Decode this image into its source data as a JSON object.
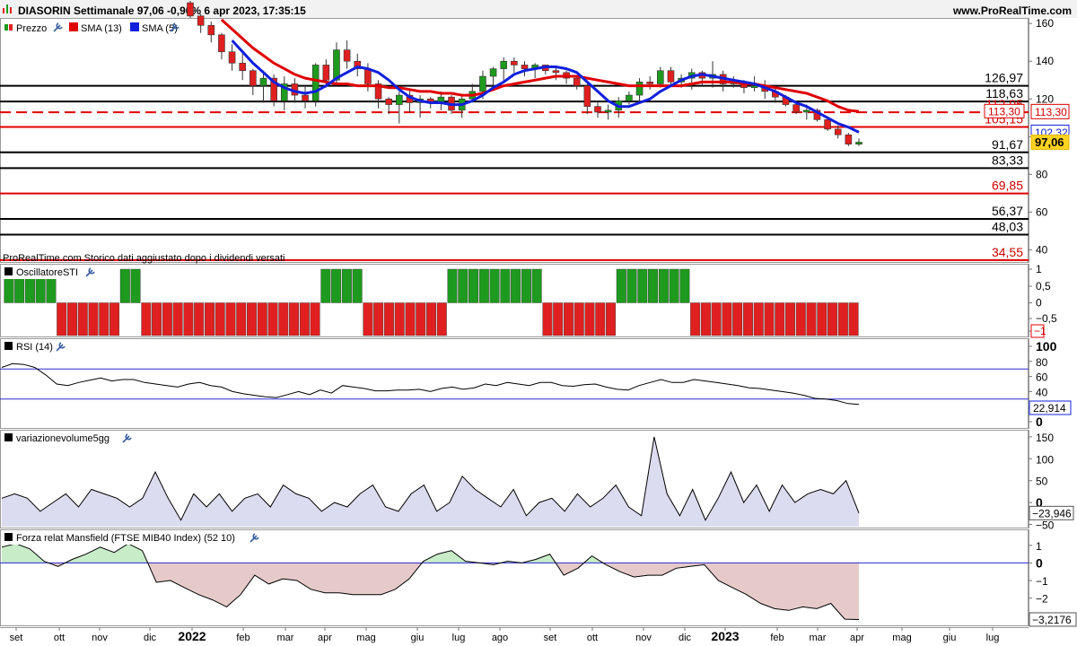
{
  "header": {
    "title": "DIASORIN Settimanale 97,06 -0,96% 6 apr 2023, 17:35:15",
    "site": "www.ProRealTime.com"
  },
  "colors": {
    "up": "#1e9a1e",
    "down": "#e02020",
    "sma13": "#e00000",
    "sma5": "#1020dd",
    "osc_pos": "#1e9a1e",
    "osc_neg": "#e02020",
    "indicator_line": "#000000",
    "level_line": "#2a2acc",
    "volume_fill": "#dcdcf0",
    "mansfield_pos_fill": "#c8ecc8",
    "mansfield_neg_fill": "#e6caca"
  },
  "price_pane": {
    "legend": [
      {
        "icon": "candlestick-icon",
        "label": "Prezzo"
      },
      {
        "icon": "red-square-icon",
        "label": "SMA (13)"
      },
      {
        "icon": "blue-square-icon",
        "label": "SMA (5)"
      }
    ],
    "note": "ProRealTime.com  Storico dati aggiustato dopo i dividendi versati",
    "ylim": [
      34,
      162
    ],
    "yticks": [
      "160",
      "140",
      "120",
      "100",
      "80",
      "60",
      "40"
    ],
    "levels": [
      {
        "label": "126,97",
        "value": 126.97,
        "style": "black-solid"
      },
      {
        "label": "118,63",
        "value": 118.63,
        "style": "black-solid"
      },
      {
        "label": "112,95",
        "value": 112.95,
        "style": "red-dashed"
      },
      {
        "label": "105,15",
        "value": 105.15,
        "style": "red-solid"
      },
      {
        "label": "91,67",
        "value": 91.67,
        "style": "black-solid"
      },
      {
        "label": "83,33",
        "value": 83.33,
        "style": "black-solid"
      },
      {
        "label": "69,85",
        "value": 69.85,
        "style": "red-solid"
      },
      {
        "label": "56,37",
        "value": 56.37,
        "style": "black-solid"
      },
      {
        "label": "48,03",
        "value": 48.03,
        "style": "black-solid"
      },
      {
        "label": "34,55",
        "value": 34.55,
        "style": "red-solid"
      }
    ],
    "price_badges": [
      {
        "label": "113,30",
        "value": 113.3,
        "style": "red"
      },
      {
        "label": "102,32",
        "value": 102.32,
        "style": "blue"
      },
      {
        "label": "97,06",
        "value": 97.06,
        "style": "yellow"
      }
    ]
  },
  "osc_pane": {
    "title": "OscillatoreSTI",
    "yticks": [
      "1",
      "0,5",
      "0",
      "−0,5",
      "−1"
    ],
    "ylim": [
      -1.2,
      1.2
    ]
  },
  "rsi_pane": {
    "title": "RSI (14)",
    "yticks": [
      "100",
      "80",
      "60",
      "40",
      "20",
      "0"
    ],
    "levels": [
      70,
      30
    ],
    "current_label": "22,914",
    "ylim": [
      0,
      100
    ]
  },
  "vol_pane": {
    "title": "variazionevolume5gg",
    "yticks": [
      "150",
      "100",
      "50",
      "0",
      "−50"
    ],
    "current_label": "−23,946",
    "ylim": [
      -55,
      160
    ]
  },
  "mansfield_pane": {
    "title": "Forza relat Mansfield (FTSE MIB40 Index) (52 10)",
    "yticks": [
      "1",
      "0",
      "−1",
      "−2",
      "−3"
    ],
    "current_label": "−3,2176",
    "ylim": [
      -3.5,
      1.4
    ]
  },
  "x_axis": {
    "labels": [
      "set",
      "ott",
      "nov",
      "dic",
      "2022",
      "feb",
      "mar",
      "apr",
      "mag",
      "giu",
      "lug",
      "ago",
      "set",
      "ott",
      "nov",
      "dic",
      "2023",
      "feb",
      "mar",
      "apr",
      "mag",
      "giu",
      "lug"
    ]
  },
  "chart_data": {
    "type": "candlestick",
    "title": "DIASORIN Settimanale",
    "series": [
      {
        "name": "Prezzo",
        "type": "candlestick",
        "ohlc": [
          [
            171,
            172,
            163,
            164
          ],
          [
            164,
            165,
            155,
            159
          ],
          [
            159,
            161,
            150,
            154
          ],
          [
            154,
            155,
            141,
            145
          ],
          [
            145,
            149,
            135,
            139
          ],
          [
            139,
            144,
            130,
            135
          ],
          [
            135,
            136,
            122,
            127
          ],
          [
            127,
            135,
            118,
            131
          ],
          [
            131,
            133,
            116,
            119
          ],
          [
            119,
            132,
            114,
            128
          ],
          [
            128,
            131,
            118,
            122
          ],
          [
            122,
            127,
            115,
            119
          ],
          [
            119,
            139,
            116,
            138
          ],
          [
            138,
            141,
            126,
            130
          ],
          [
            130,
            150,
            127,
            146
          ],
          [
            146,
            151,
            136,
            140
          ],
          [
            140,
            144,
            132,
            136
          ],
          [
            136,
            139,
            124,
            128
          ],
          [
            128,
            130,
            115,
            120
          ],
          [
            120,
            121,
            112,
            117
          ],
          [
            117,
            124,
            107,
            122
          ],
          [
            122,
            125,
            113,
            118
          ],
          [
            118,
            122,
            110,
            120
          ],
          [
            120,
            121,
            115,
            118
          ],
          [
            118,
            124,
            114,
            121
          ],
          [
            121,
            122,
            112,
            114
          ],
          [
            114,
            122,
            110,
            120
          ],
          [
            120,
            128,
            118,
            124
          ],
          [
            124,
            135,
            120,
            132
          ],
          [
            132,
            137,
            126,
            136
          ],
          [
            136,
            142,
            129,
            140
          ],
          [
            140,
            142,
            134,
            138
          ],
          [
            138,
            140,
            132,
            136
          ],
          [
            136,
            139,
            131,
            138
          ],
          [
            138,
            138,
            133,
            135
          ],
          [
            135,
            137,
            130,
            134
          ],
          [
            134,
            135,
            128,
            131
          ],
          [
            131,
            132,
            125,
            127
          ],
          [
            127,
            128,
            112,
            116
          ],
          [
            116,
            118,
            110,
            113
          ],
          [
            113,
            117,
            109,
            114
          ],
          [
            114,
            121,
            110,
            119
          ],
          [
            119,
            124,
            117,
            122
          ],
          [
            122,
            131,
            119,
            129
          ],
          [
            129,
            132,
            125,
            128
          ],
          [
            128,
            137,
            126,
            135
          ],
          [
            135,
            137,
            127,
            129
          ],
          [
            129,
            133,
            126,
            131
          ],
          [
            131,
            136,
            125,
            134
          ],
          [
            134,
            135,
            127,
            131
          ],
          [
            131,
            140,
            126,
            133
          ],
          [
            133,
            135,
            124,
            128
          ],
          [
            128,
            132,
            126,
            129
          ],
          [
            129,
            130,
            123,
            126
          ],
          [
            126,
            132,
            124,
            127
          ],
          [
            127,
            130,
            120,
            124
          ],
          [
            124,
            127,
            118,
            121
          ],
          [
            121,
            122,
            116,
            117
          ],
          [
            117,
            119,
            112,
            113
          ],
          [
            113,
            117,
            109,
            114
          ],
          [
            114,
            115,
            108,
            109
          ],
          [
            109,
            110,
            103,
            104
          ],
          [
            104,
            106,
            99,
            101
          ],
          [
            101,
            102,
            95,
            96
          ],
          [
            96,
            99,
            95,
            97.06
          ]
        ]
      },
      {
        "name": "SMA (13)",
        "type": "line",
        "values": [
          null,
          null,
          null,
          162,
          157,
          152,
          147,
          143,
          139,
          136,
          133,
          131,
          130,
          129,
          128,
          128,
          127,
          127,
          127,
          126,
          126,
          125,
          124,
          124,
          123,
          123,
          122,
          122,
          123,
          125,
          127,
          128,
          129,
          130,
          131,
          132,
          132,
          132,
          131,
          130,
          129,
          128,
          127,
          127,
          127,
          127,
          127,
          127,
          128,
          129,
          129,
          129,
          129,
          128,
          128,
          127,
          126,
          125,
          124,
          123,
          121,
          119,
          116,
          114,
          113.3
        ]
      },
      {
        "name": "SMA (5)",
        "type": "line",
        "values": [
          null,
          null,
          null,
          null,
          151,
          145,
          139,
          134,
          129,
          126,
          124,
          123,
          124,
          127,
          131,
          134,
          137,
          136,
          134,
          130,
          125,
          121,
          119,
          118,
          118,
          117,
          117,
          119,
          122,
          126,
          129,
          133,
          135,
          136,
          137,
          137,
          136,
          134,
          129,
          124,
          119,
          116,
          116,
          118,
          120,
          124,
          127,
          130,
          132,
          133,
          132,
          131,
          130,
          129,
          128,
          126,
          124,
          121,
          118,
          116,
          113,
          110,
          107,
          105,
          102.32
        ]
      }
    ],
    "oscillator_sti": [
      1,
      1,
      1,
      1,
      1,
      -1,
      -1,
      -1,
      -1,
      -1,
      -1,
      1,
      1,
      -1,
      -1,
      -1,
      -1,
      -1,
      -1,
      -1,
      -1,
      -1,
      -1,
      -1,
      -1,
      -1,
      -1,
      -1,
      -1,
      -1,
      1,
      1,
      1,
      1,
      -1,
      -1,
      -1,
      -1,
      -1,
      -1,
      -1,
      -1,
      1,
      1,
      1,
      1,
      1,
      1,
      1,
      1,
      1,
      -1,
      -1,
      -1,
      -1,
      -1,
      -1,
      -1,
      1,
      1,
      1,
      1,
      1,
      1,
      1,
      -1,
      -1,
      -1,
      -1,
      -1,
      -1,
      -1,
      -1,
      -1,
      -1,
      -1,
      -1,
      -1,
      -1,
      -1,
      -1
    ],
    "rsi": [
      72,
      77,
      76,
      72,
      62,
      50,
      48,
      52,
      55,
      58,
      54,
      56,
      56,
      52,
      50,
      48,
      46,
      50,
      52,
      48,
      46,
      40,
      37,
      35,
      33,
      32,
      36,
      40,
      36,
      42,
      38,
      48,
      46,
      44,
      41,
      41,
      42,
      42,
      43,
      40,
      44,
      46,
      43,
      45,
      50,
      48,
      52,
      50,
      48,
      52,
      52,
      48,
      47,
      49,
      50,
      46,
      43,
      42,
      48,
      52,
      56,
      52,
      52,
      56,
      54,
      52,
      50,
      48,
      45,
      44,
      42,
      40,
      38,
      35,
      31,
      30,
      28,
      24,
      22.914
    ],
    "variazione_volume_5gg": [
      10,
      20,
      10,
      -20,
      0,
      20,
      -10,
      30,
      20,
      10,
      -10,
      10,
      70,
      10,
      -40,
      20,
      -10,
      20,
      -20,
      10,
      20,
      -10,
      40,
      20,
      10,
      -20,
      0,
      -10,
      20,
      40,
      -10,
      -20,
      20,
      40,
      -20,
      0,
      60,
      30,
      10,
      -10,
      30,
      -30,
      0,
      10,
      -20,
      20,
      -10,
      10,
      40,
      -10,
      -30,
      150,
      20,
      -30,
      30,
      -40,
      10,
      70,
      0,
      40,
      -20,
      40,
      0,
      20,
      30,
      20,
      50,
      -23.946
    ],
    "mansfield": [
      0.9,
      1.1,
      0.8,
      0.1,
      -0.2,
      0.2,
      0.5,
      0.9,
      0.6,
      1.1,
      0.7,
      -1.1,
      -1.0,
      -1.4,
      -1.8,
      -2.1,
      -2.5,
      -1.8,
      -0.7,
      -1.2,
      -0.9,
      -1.0,
      -1.5,
      -1.7,
      -1.7,
      -1.8,
      -1.8,
      -1.8,
      -1.5,
      -0.9,
      0.1,
      0.5,
      0.7,
      0.1,
      0,
      -0.1,
      0.1,
      0,
      0.2,
      0.5,
      -0.7,
      -0.3,
      0.4,
      -0.1,
      -0.5,
      -0.8,
      -0.7,
      -0.7,
      -0.3,
      -0.2,
      -0.1,
      -1,
      -1.4,
      -1.8,
      -2.3,
      -2.6,
      -2.7,
      -2.5,
      -2.6,
      -2.3,
      -3.2,
      -3.2176
    ]
  }
}
